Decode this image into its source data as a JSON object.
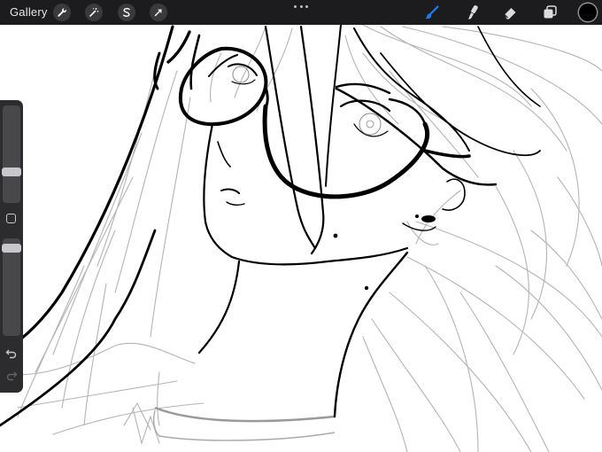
{
  "app": {
    "gallery_label": "Gallery"
  },
  "toolbar": {
    "left_tools": [
      "wrench-icon",
      "magic-wand-icon",
      "selection-icon",
      "transform-arrow-icon"
    ],
    "right_tools": [
      "brush-icon",
      "smudge-icon",
      "eraser-icon",
      "layers-icon"
    ],
    "active_tool": "brush-icon",
    "active_color": "#000000",
    "accent_color": "#1e7cf2"
  },
  "sidebar": {
    "brush_size_level": 0.35,
    "opacity_level": 0.05,
    "buttons": [
      "modify-square-icon",
      "undo-icon",
      "redo-icon"
    ]
  }
}
